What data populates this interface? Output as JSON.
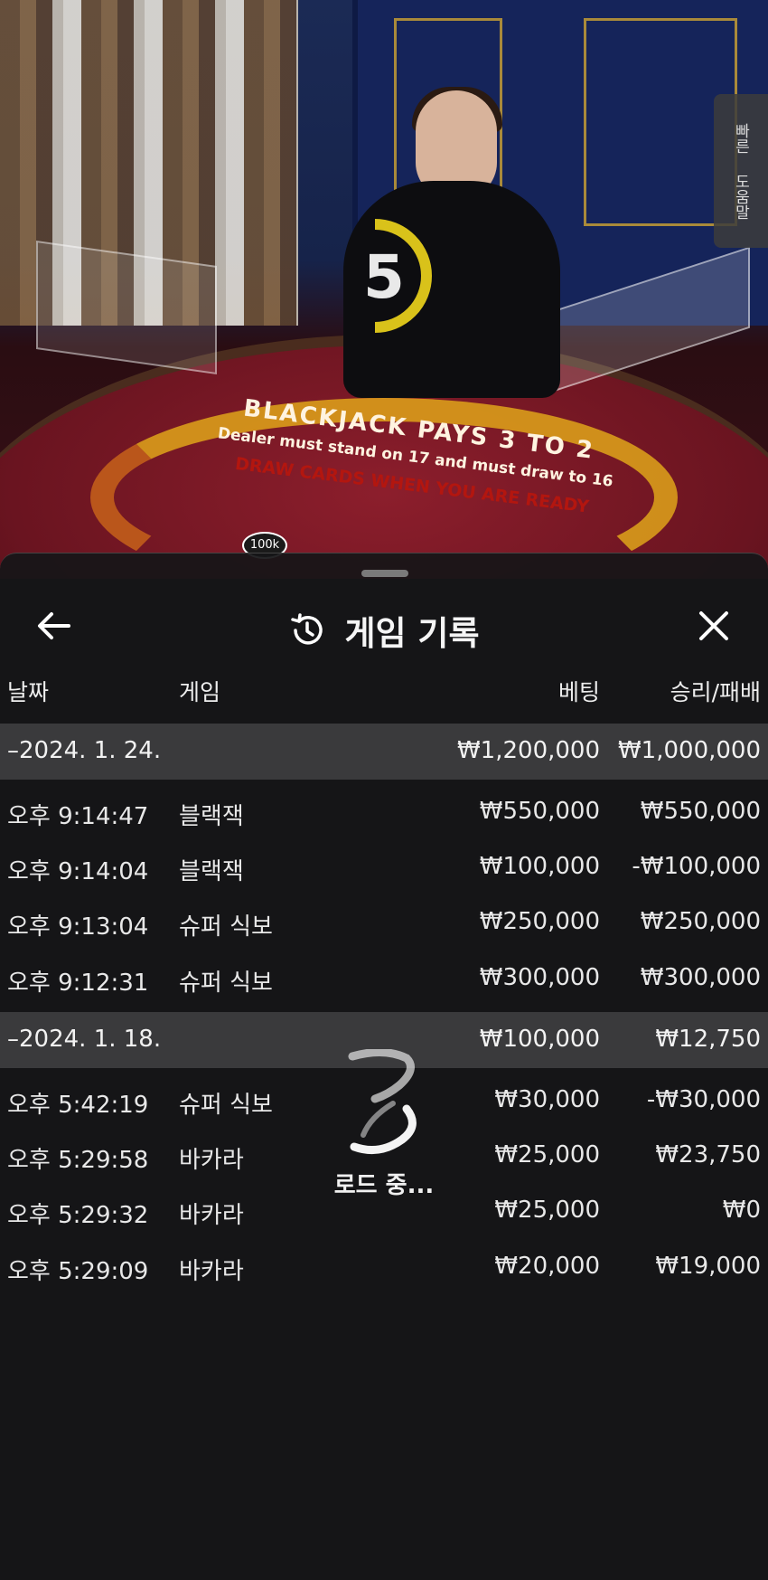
{
  "scene": {
    "timer": "5",
    "help_tab": {
      "line1": "빠른",
      "line2": "도움말"
    },
    "table_text": {
      "line1": "BLACKJACK PAYS 3 TO 2",
      "line2": "Dealer must stand on 17 and must draw to 16",
      "line3": "DRAW CARDS WHEN YOU ARE READY"
    },
    "chip_label": "100k"
  },
  "panel": {
    "title": "게임 기록",
    "columns": {
      "date": "날짜",
      "game": "게임",
      "bet": "베팅",
      "win_loss": "승리/패배"
    },
    "groups": [
      {
        "date": "–2024. 1. 24.",
        "bet_total": "₩1,200,000",
        "win_total": "₩1,000,000",
        "rows": [
          {
            "time": "오후 9:14:47",
            "game": "블랙잭",
            "bet": "₩550,000",
            "result": "₩550,000"
          },
          {
            "time": "오후 9:14:04",
            "game": "블랙잭",
            "bet": "₩100,000",
            "result": "-₩100,000"
          },
          {
            "time": "오후 9:13:04",
            "game": "슈퍼 식보",
            "bet": "₩250,000",
            "result": "₩250,000"
          },
          {
            "time": "오후 9:12:31",
            "game": "슈퍼 식보",
            "bet": "₩300,000",
            "result": "₩300,000"
          }
        ]
      },
      {
        "date": "–2024. 1. 18.",
        "bet_total": "₩100,000",
        "win_total": "₩12,750",
        "rows": [
          {
            "time": "오후 5:42:19",
            "game": "슈퍼 식보",
            "bet": "₩30,000",
            "result": "-₩30,000"
          },
          {
            "time": "오후 5:29:58",
            "game": "바카라",
            "bet": "₩25,000",
            "result": "₩23,750"
          },
          {
            "time": "오후 5:29:32",
            "game": "바카라",
            "bet": "₩25,000",
            "result": "₩0"
          },
          {
            "time": "오후 5:29:09",
            "game": "바카라",
            "bet": "₩20,000",
            "result": "₩19,000"
          }
        ]
      }
    ],
    "loading_text": "로드 중..."
  },
  "colors": {
    "panel_bg": "#161618",
    "group_bg": "#3a3a3c",
    "timer_ring": "#d9c21a"
  },
  "icons": {
    "back": "arrow-left-icon",
    "history": "history-clock-icon",
    "close": "close-icon",
    "loader": "spinner-logo-icon"
  }
}
